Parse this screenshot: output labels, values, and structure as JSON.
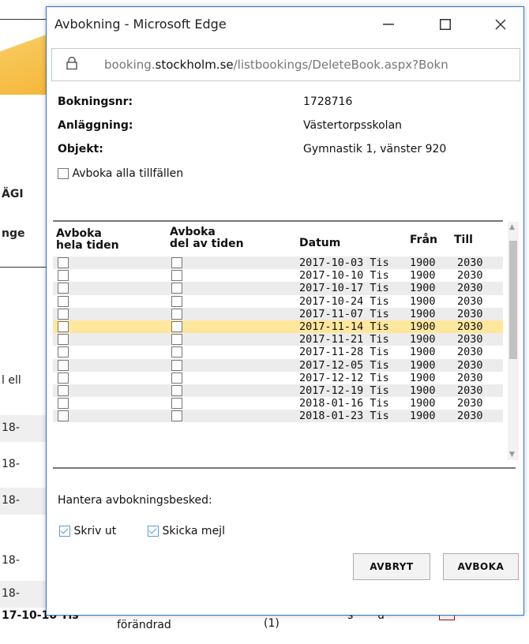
{
  "background": {
    "left_texts": [
      "ÄGI",
      "nge",
      "l ell",
      "18-",
      "18-",
      "18-",
      "18-",
      "18-"
    ],
    "bottom_row": {
      "date": "17-10-10 Tis",
      "status": "förändrad",
      "count": "(1)",
      "s": "s",
      "u": "u"
    }
  },
  "window": {
    "title": "Avbokning - Microsoft Edge",
    "url_prefix": "booking.",
    "url_domain": "stockholm.se",
    "url_path": "/listbookings/DeleteBook.aspx?Bokn"
  },
  "details": {
    "bokningsnr_label": "Bokningsnr:",
    "bokningsnr_value": "1728716",
    "anlaggning_label": "Anläggning:",
    "anlaggning_value": "Västertorpsskolan",
    "objekt_label": "Objekt:",
    "objekt_value": "Gymnastik 1, vänster 920",
    "avboka_alla_label": "Avboka alla tillfällen"
  },
  "table": {
    "headers": {
      "hela_line1": "Avboka",
      "hela_line2": "hela tiden",
      "del_line1": "Avboka",
      "del_line2": "del av tiden",
      "datum": "Datum",
      "fran": "Från",
      "till": "Till"
    },
    "rows": [
      {
        "datum": "2017-10-03 Tis",
        "fran": "1900",
        "till": "2030"
      },
      {
        "datum": "2017-10-10 Tis",
        "fran": "1900",
        "till": "2030"
      },
      {
        "datum": "2017-10-17 Tis",
        "fran": "1900",
        "till": "2030"
      },
      {
        "datum": "2017-10-24 Tis",
        "fran": "1900",
        "till": "2030"
      },
      {
        "datum": "2017-11-07 Tis",
        "fran": "1900",
        "till": "2030"
      },
      {
        "datum": "2017-11-14 Tis",
        "fran": "1900",
        "till": "2030"
      },
      {
        "datum": "2017-11-21 Tis",
        "fran": "1900",
        "till": "2030"
      },
      {
        "datum": "2017-11-28 Tis",
        "fran": "1900",
        "till": "2030"
      },
      {
        "datum": "2017-12-05 Tis",
        "fran": "1900",
        "till": "2030"
      },
      {
        "datum": "2017-12-12 Tis",
        "fran": "1900",
        "till": "2030"
      },
      {
        "datum": "2017-12-19 Tis",
        "fran": "1900",
        "till": "2030"
      },
      {
        "datum": "2018-01-16 Tis",
        "fran": "1900",
        "till": "2030"
      },
      {
        "datum": "2018-01-23 Tis",
        "fran": "1900",
        "till": "2030"
      }
    ]
  },
  "notify": {
    "heading": "Hantera avbokningsbesked:",
    "skriv_ut": "Skriv ut",
    "skicka_mejl": "Skicka mejl"
  },
  "buttons": {
    "avbryt": "AVBRYT",
    "avboka": "AVBOKA"
  },
  "colors": {
    "highlight_row": "#fde79c",
    "alt_row": "#ececec",
    "window_border": "#2a78c7"
  }
}
